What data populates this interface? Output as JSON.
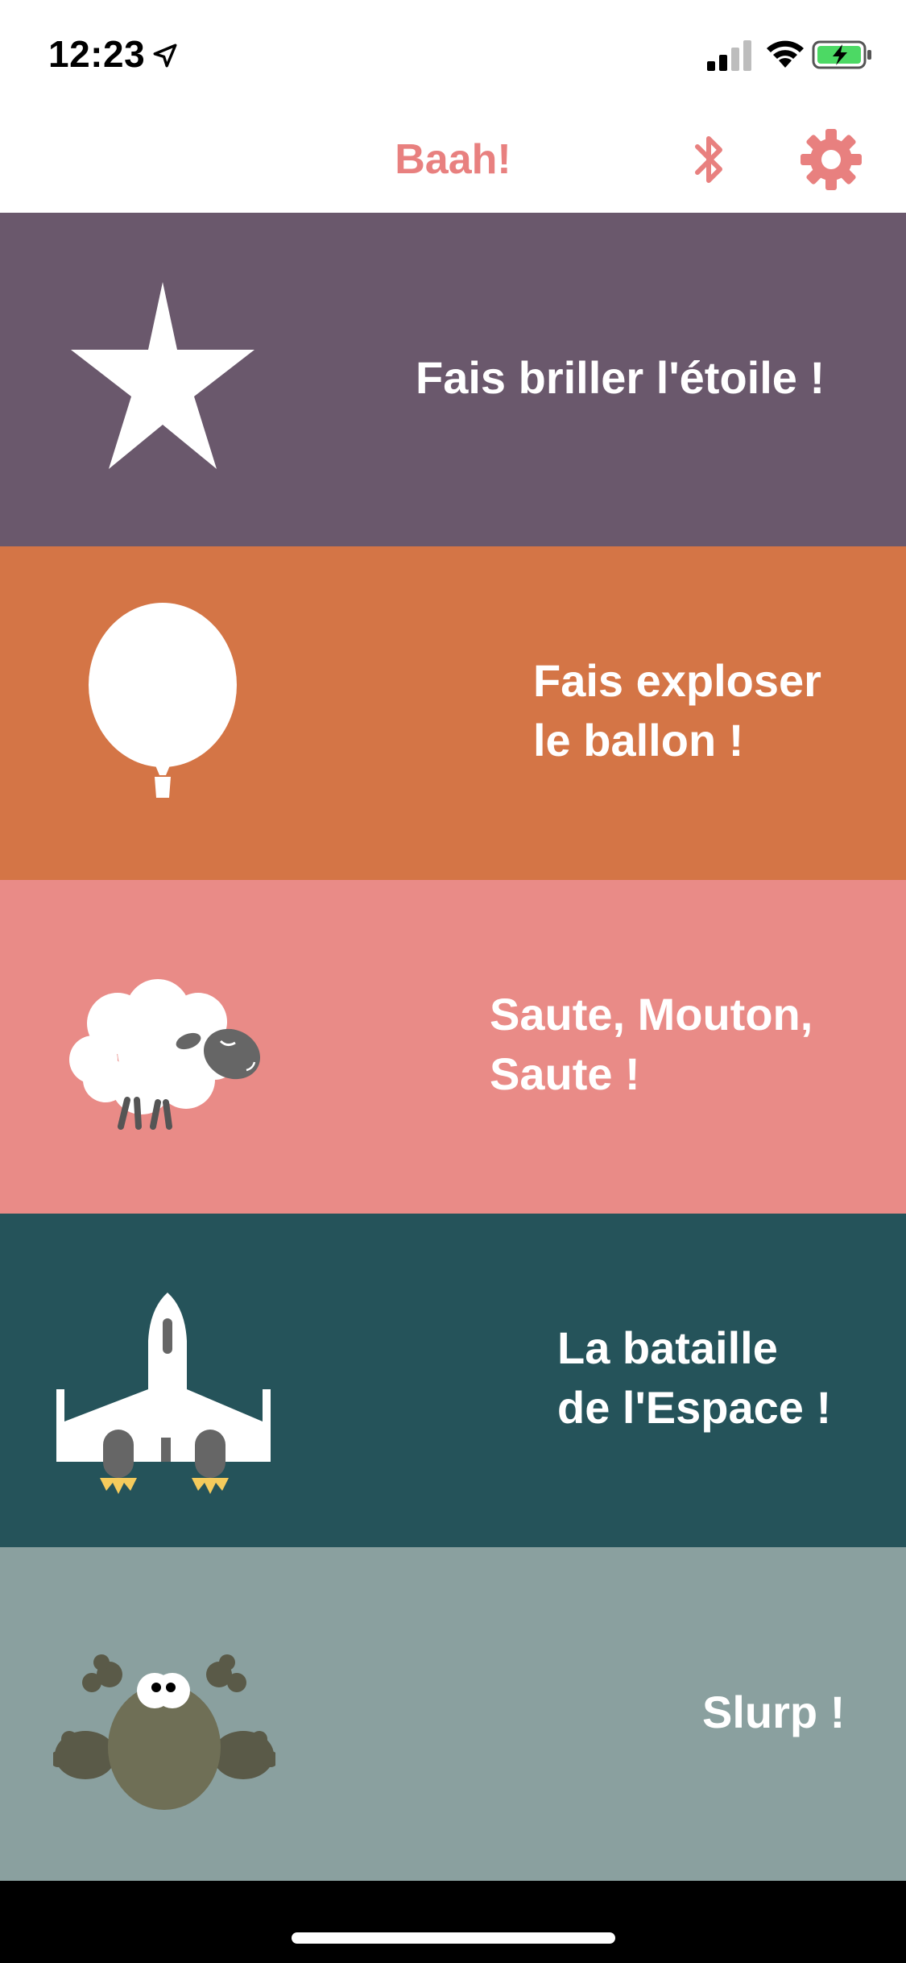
{
  "status_bar": {
    "time": "12:23",
    "location_icon": "location-arrow-icon",
    "signal_icon": "cellular-signal-icon",
    "wifi_icon": "wifi-icon",
    "battery_icon": "battery-charging-icon"
  },
  "nav": {
    "title": "Baah!",
    "accent_color": "#E8807F",
    "bluetooth_icon": "bluetooth-icon",
    "settings_icon": "gear-icon"
  },
  "games": [
    {
      "lines": [
        "Fais briller l'étoile !"
      ],
      "color": "#6A586C",
      "icon": "star-icon"
    },
    {
      "lines": [
        "Fais exploser",
        "le ballon !"
      ],
      "color": "#D47546",
      "icon": "balloon-icon"
    },
    {
      "lines": [
        "Saute, Mouton,",
        "Saute !"
      ],
      "color": "#E98B87",
      "icon": "sheep-icon"
    },
    {
      "lines": [
        "La bataille",
        "de l'Espace !"
      ],
      "color": "#25535A",
      "icon": "spaceship-icon"
    },
    {
      "lines": [
        "Slurp !"
      ],
      "color": "#8AA09F",
      "icon": "frog-icon"
    }
  ]
}
